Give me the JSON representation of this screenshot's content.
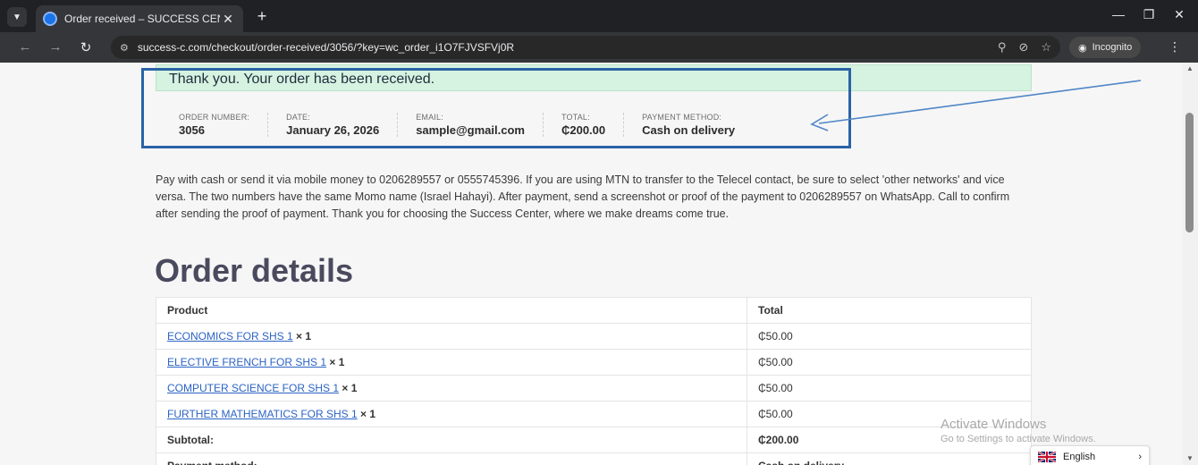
{
  "browser": {
    "tab_title": "Order received – SUCCESS CEN",
    "url": "success-c.com/checkout/order-received/3056/?key=wc_order_i1O7FJVSFVj0R",
    "incognito_label": "Incognito"
  },
  "notice": {
    "text": "Thank you. Your order has been received."
  },
  "overview": [
    {
      "label": "ORDER NUMBER:",
      "value": "3056"
    },
    {
      "label": "DATE:",
      "value": "January 26, 2026"
    },
    {
      "label": "EMAIL:",
      "value": "sample@gmail.com"
    },
    {
      "label": "TOTAL:",
      "value": "₵200.00"
    },
    {
      "label": "PAYMENT METHOD:",
      "value": "Cash on delivery"
    }
  ],
  "instructions": "Pay with cash or send it via mobile money to 0206289557 or 0555745396. If you are using MTN to transfer to the Telecel contact, be sure to select 'other networks' and vice versa. The two numbers have the same Momo name (Israel Hahayi). After payment, send a screenshot or proof of the payment to 0206289557 on WhatsApp. Call to confirm after sending the proof of payment. Thank you for choosing the Success Center, where we make dreams come true.",
  "order_details": {
    "title": "Order details",
    "headers": {
      "product": "Product",
      "total": "Total"
    },
    "items": [
      {
        "name": "ECONOMICS FOR SHS 1",
        "qty": "× 1",
        "total": "₵50.00"
      },
      {
        "name": "ELECTIVE FRENCH FOR SHS 1",
        "qty": "× 1",
        "total": "₵50.00"
      },
      {
        "name": "COMPUTER SCIENCE FOR SHS 1",
        "qty": "× 1",
        "total": "₵50.00"
      },
      {
        "name": "FURTHER MATHEMATICS FOR SHS 1",
        "qty": "× 1",
        "total": "₵50.00"
      }
    ],
    "subtotal": {
      "label": "Subtotal:",
      "value": "₵200.00"
    },
    "payment": {
      "label": "Payment method:",
      "value": "Cash on delivery"
    }
  },
  "watermark": {
    "title": "Activate Windows",
    "subtitle": "Go to Settings to activate Windows."
  },
  "language": {
    "label": "English"
  },
  "colors": {
    "notice_bg": "#d6f2e0",
    "annotation": "#2a63a5",
    "link": "#2b63c4"
  }
}
